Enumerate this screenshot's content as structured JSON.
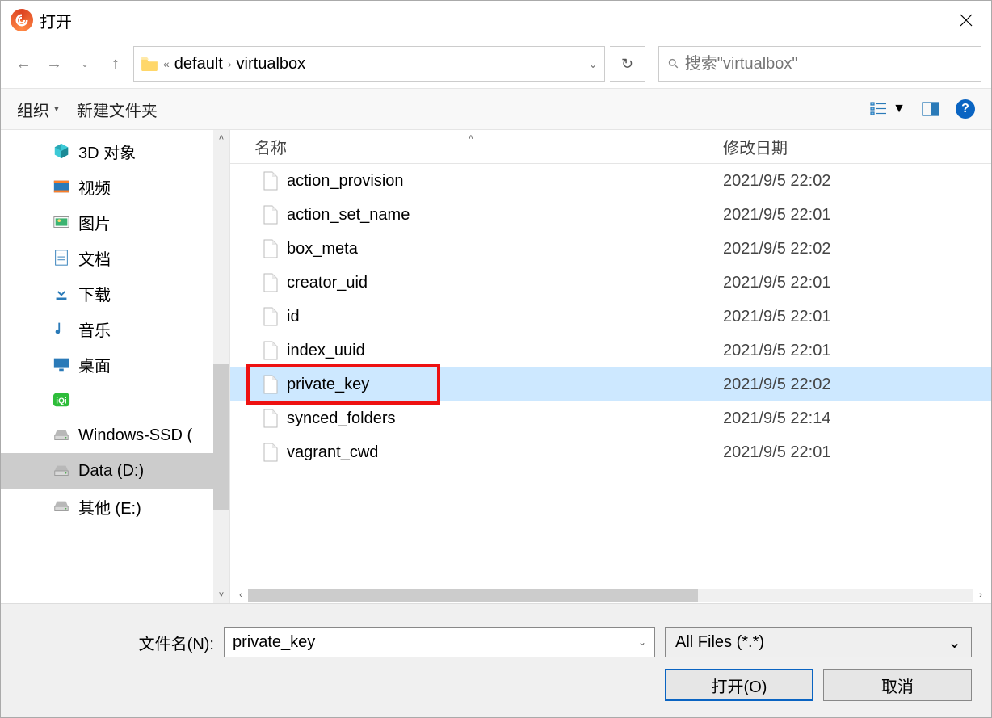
{
  "title": "打开",
  "breadcrumb": {
    "ellipsis": "«",
    "parts": [
      "default",
      "virtualbox"
    ]
  },
  "search": {
    "placeholder": "搜索\"virtualbox\""
  },
  "toolbar": {
    "organize": "组织",
    "newfolder": "新建文件夹"
  },
  "sidebar": {
    "items": [
      {
        "label": "3D 对象",
        "icon": "cube",
        "selected": false
      },
      {
        "label": "视频",
        "icon": "video",
        "selected": false
      },
      {
        "label": "图片",
        "icon": "picture",
        "selected": false
      },
      {
        "label": "文档",
        "icon": "doc",
        "selected": false
      },
      {
        "label": "下载",
        "icon": "download",
        "selected": false
      },
      {
        "label": "音乐",
        "icon": "music",
        "selected": false
      },
      {
        "label": "桌面",
        "icon": "desktop",
        "selected": false
      },
      {
        "label": "",
        "icon": "iqiyi",
        "selected": false
      },
      {
        "label": "Windows-SSD (",
        "icon": "drive",
        "selected": false
      },
      {
        "label": "Data (D:)",
        "icon": "drive",
        "selected": true
      },
      {
        "label": "其他 (E:)",
        "icon": "drive",
        "selected": false
      }
    ]
  },
  "columns": {
    "name": "名称",
    "date": "修改日期"
  },
  "files": [
    {
      "name": "action_provision",
      "date": "2021/9/5 22:02",
      "selected": false
    },
    {
      "name": "action_set_name",
      "date": "2021/9/5 22:01",
      "selected": false
    },
    {
      "name": "box_meta",
      "date": "2021/9/5 22:02",
      "selected": false
    },
    {
      "name": "creator_uid",
      "date": "2021/9/5 22:01",
      "selected": false
    },
    {
      "name": "id",
      "date": "2021/9/5 22:01",
      "selected": false
    },
    {
      "name": "index_uuid",
      "date": "2021/9/5 22:01",
      "selected": false
    },
    {
      "name": "private_key",
      "date": "2021/9/5 22:02",
      "selected": true,
      "highlighted": true
    },
    {
      "name": "synced_folders",
      "date": "2021/9/5 22:14",
      "selected": false
    },
    {
      "name": "vagrant_cwd",
      "date": "2021/9/5 22:01",
      "selected": false
    }
  ],
  "filename": {
    "label": "文件名(N):",
    "value": "private_key"
  },
  "filter": {
    "value": "All Files (*.*)"
  },
  "buttons": {
    "open": "打开(O)",
    "cancel": "取消"
  }
}
